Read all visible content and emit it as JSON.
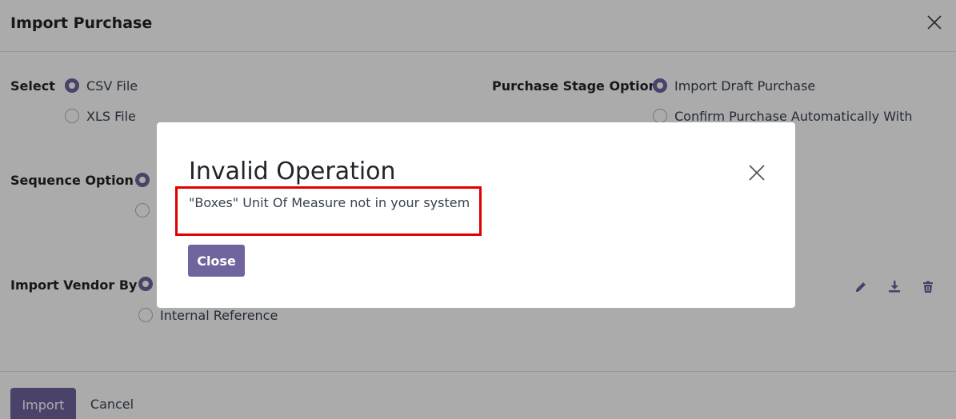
{
  "dialog": {
    "title": "Import Purchase",
    "close_icon": "close-icon",
    "select": {
      "label": "Select",
      "options": [
        {
          "label": "CSV File",
          "checked": true
        },
        {
          "label": "XLS File",
          "checked": false
        }
      ]
    },
    "purchase_stage": {
      "label": "Purchase Stage Option",
      "options": [
        {
          "label": "Import Draft Purchase",
          "checked": true
        },
        {
          "label": "Confirm Purchase Automatically With",
          "checked": false
        }
      ]
    },
    "sequence": {
      "label": "Sequence Option"
    },
    "vendor": {
      "label": "Import Vendor By",
      "options": [
        {
          "label": "",
          "checked": true
        },
        {
          "label": "Internal Reference",
          "checked": false
        }
      ]
    },
    "toolbar_icons": [
      "pencil-icon",
      "download-icon",
      "trash-icon"
    ],
    "footer": {
      "import_label": "Import",
      "cancel_label": "Cancel"
    }
  },
  "modal": {
    "title": "Invalid Operation",
    "message": "\"Boxes\" Unit Of Measure not in your system",
    "close_label": "Close",
    "close_icon": "close-icon"
  },
  "colors": {
    "primary": "#71639e",
    "highlight": "#e00000",
    "backdrop": "rgba(0,0,0,0.33)"
  }
}
